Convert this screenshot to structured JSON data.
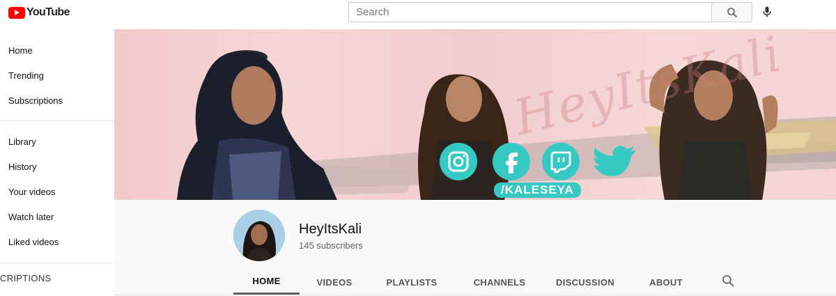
{
  "topbar": {
    "logo_text": "YouTube",
    "search_placeholder": "Search",
    "search_icon": "search-icon",
    "mic_icon": "microphone-icon"
  },
  "sidebar": {
    "items": [
      {
        "label": "Home"
      },
      {
        "label": "Trending"
      },
      {
        "label": "Subscriptions"
      },
      {
        "label": "Library"
      },
      {
        "label": "History"
      },
      {
        "label": "Your videos"
      },
      {
        "label": "Watch later"
      },
      {
        "label": "Liked videos"
      }
    ],
    "section_heading": "CRIPTIONS"
  },
  "banner": {
    "watermark_text": "HeyItsKali",
    "handle_text": "/KALESEYA",
    "social_icons": [
      "instagram-icon",
      "facebook-icon",
      "twitch-icon",
      "twitter-icon"
    ],
    "accent_color": "#36c9c3"
  },
  "channel": {
    "name": "HeyItsKali",
    "subscribers": "145 subscribers"
  },
  "tabs": [
    {
      "label": "HOME",
      "active": true
    },
    {
      "label": "VIDEOS",
      "active": false
    },
    {
      "label": "PLAYLISTS",
      "active": false
    },
    {
      "label": "CHANNELS",
      "active": false
    },
    {
      "label": "DISCUSSION",
      "active": false
    },
    {
      "label": "ABOUT",
      "active": false
    }
  ],
  "colors": {
    "brand_red": "#ff0000",
    "banner_pink": "#f3c9cb"
  }
}
